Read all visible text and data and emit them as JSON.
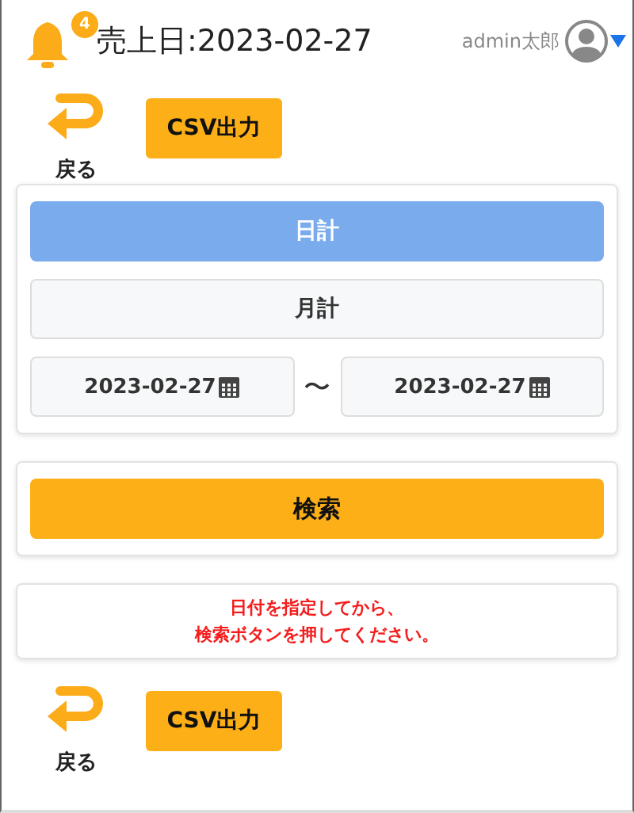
{
  "header": {
    "notification_count": "4",
    "title": "売上日:2023-02-27",
    "user_name": "admin太郎"
  },
  "toolbars": [
    {
      "back_label": "戻る",
      "export_label": "CSV出力"
    },
    {
      "back_label": "戻る",
      "export_label": "CSV出力"
    }
  ],
  "period_tabs": [
    {
      "label": "日計",
      "selected": true
    },
    {
      "label": "月計",
      "selected": false
    }
  ],
  "date_range": {
    "from": "2023-02-27",
    "separator": "〜",
    "to": "2023-02-27"
  },
  "search_button": "検索",
  "message": [
    "日付を指定してから、",
    "検索ボタンを押してください。"
  ]
}
